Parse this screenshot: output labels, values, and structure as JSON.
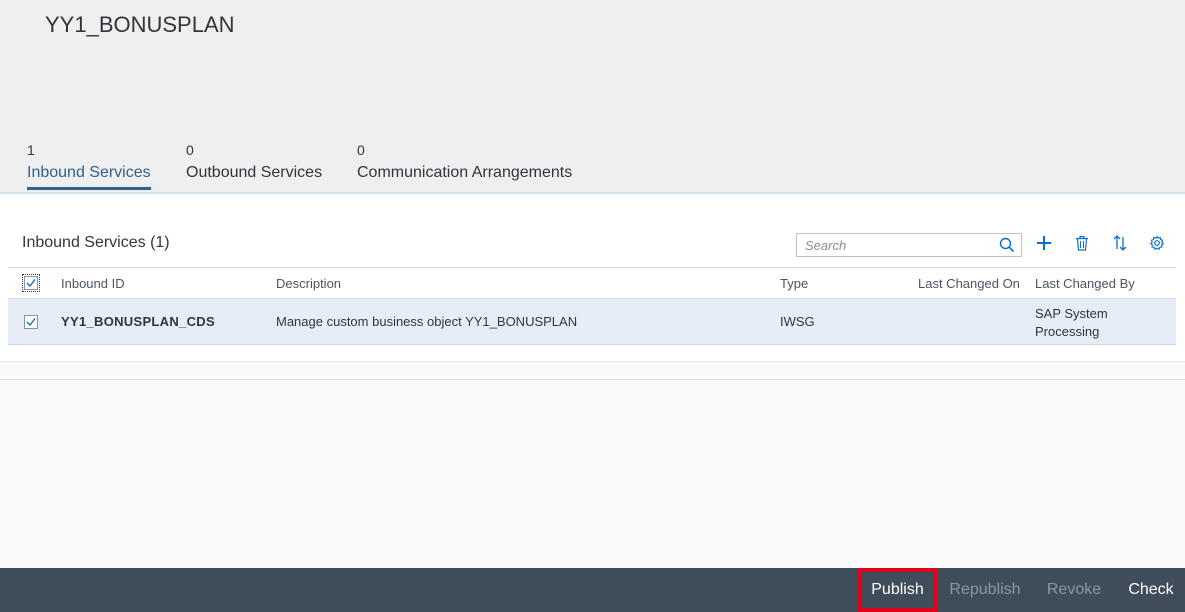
{
  "page": {
    "title": "YY1_BONUSPLAN"
  },
  "tabs": [
    {
      "count": "1",
      "label": "Inbound Services"
    },
    {
      "count": "0",
      "label": "Outbound Services"
    },
    {
      "count": "0",
      "label": "Communication Arrangements"
    }
  ],
  "table": {
    "title": "Inbound Services (1)",
    "search_placeholder": "Search",
    "columns": {
      "inbound_id": "Inbound ID",
      "description": "Description",
      "type": "Type",
      "last_changed_on": "Last Changed On",
      "last_changed_by": "Last Changed By"
    },
    "rows": [
      {
        "inbound_id": "YY1_BONUSPLAN_CDS",
        "description": "Manage custom business object YY1_BONUSPLAN",
        "type": "IWSG",
        "last_changed_on": "",
        "last_changed_by_line1": "SAP System",
        "last_changed_by_line2": "Processing",
        "selected": true
      }
    ]
  },
  "icons": {
    "search": "search-icon",
    "add": "add-icon",
    "delete": "trash-icon",
    "sort": "sort-icon",
    "settings": "gear-icon"
  },
  "footer": {
    "publish": "Publish",
    "republish": "Republish",
    "revoke": "Revoke",
    "check": "Check"
  },
  "colors": {
    "accent": "#346187",
    "icon": "#0a6ed1",
    "footer_bg": "#3f4c59",
    "highlight": "#e3001b"
  }
}
